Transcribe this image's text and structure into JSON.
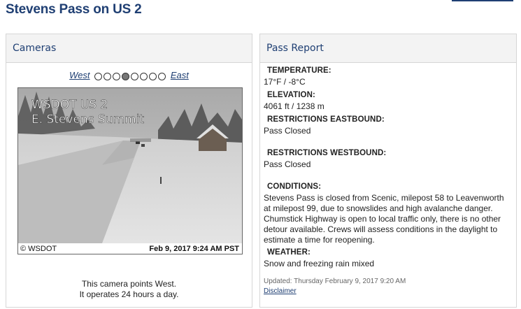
{
  "page": {
    "title": "Stevens Pass on US 2"
  },
  "cameras": {
    "heading": "Cameras",
    "nav": {
      "west": "West",
      "east": "East",
      "dot_count": 8,
      "active_index": 3
    },
    "image": {
      "overlay_line1": "WSDOT US 2",
      "overlay_line2": "E. Stevens Summit",
      "copyright": "© WSDOT",
      "timestamp": "Feb 9, 2017 9:24 AM PST"
    },
    "caption_line1": "This camera points West.",
    "caption_line2": "It operates 24 hours a day."
  },
  "pass_report": {
    "heading": "Pass Report",
    "temperature_label": "TEMPERATURE:",
    "temperature_value": "17°F / -8°C",
    "elevation_label": "ELEVATION:",
    "elevation_value": "4061 ft / 1238 m",
    "eastbound_label": "RESTRICTIONS EASTBOUND:",
    "eastbound_value": "Pass Closed",
    "westbound_label": "RESTRICTIONS WESTBOUND:",
    "westbound_value": "Pass Closed",
    "conditions_label": "CONDITIONS:",
    "conditions_value": "Stevens Pass is closed from Scenic, milepost 58 to Leavenworth at milepost 99, due to snowslides and high avalanche danger. Chumstick Highway is open to local traffic only, there is no other detour available. Crews will assess conditions in the daylight to estimate a time for reopening.",
    "weather_label": "WEATHER:",
    "weather_value": "Snow and freezing rain mixed",
    "updated": "Updated: Thursday February 9, 2017 9:20 AM",
    "disclaimer": "Disclaimer"
  }
}
